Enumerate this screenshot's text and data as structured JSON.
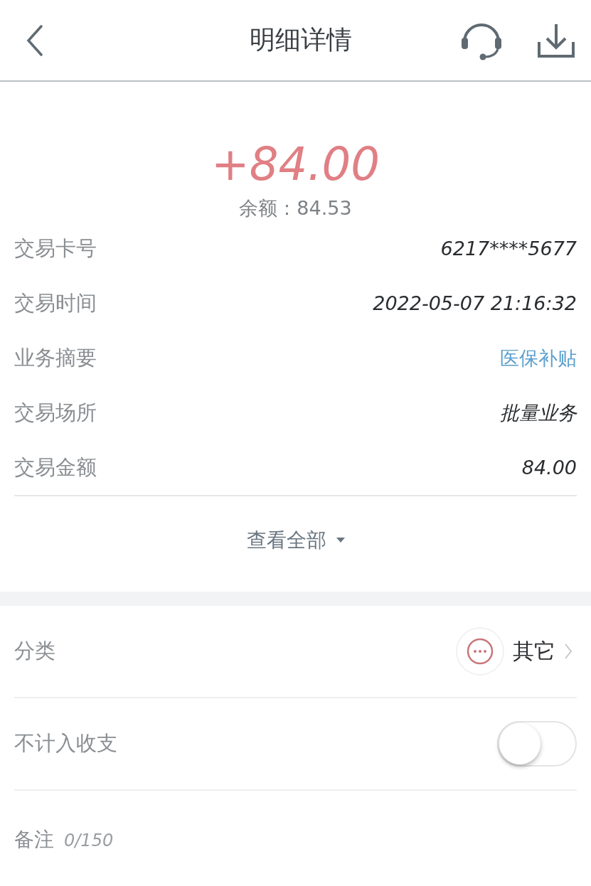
{
  "header": {
    "title": "明细详情"
  },
  "amount": "+84.00",
  "balance": "余额：84.53",
  "details": [
    {
      "label": "交易卡号",
      "value": "6217****5677",
      "link": false
    },
    {
      "label": "交易时间",
      "value": "2022-05-07 21:16:32",
      "link": false
    },
    {
      "label": "业务摘要",
      "value": "医保补贴",
      "link": true
    },
    {
      "label": "交易场所",
      "value": "批量业务",
      "link": false
    },
    {
      "label": "交易金额",
      "value": "84.00",
      "link": false
    }
  ],
  "view_all": "查看全部",
  "settings": [
    {
      "kind": "category",
      "label": "分类",
      "value": "其它"
    },
    {
      "kind": "toggle",
      "label": "不计入收支",
      "on": false
    }
  ],
  "note": {
    "label": "备注",
    "counter": "0/150"
  }
}
